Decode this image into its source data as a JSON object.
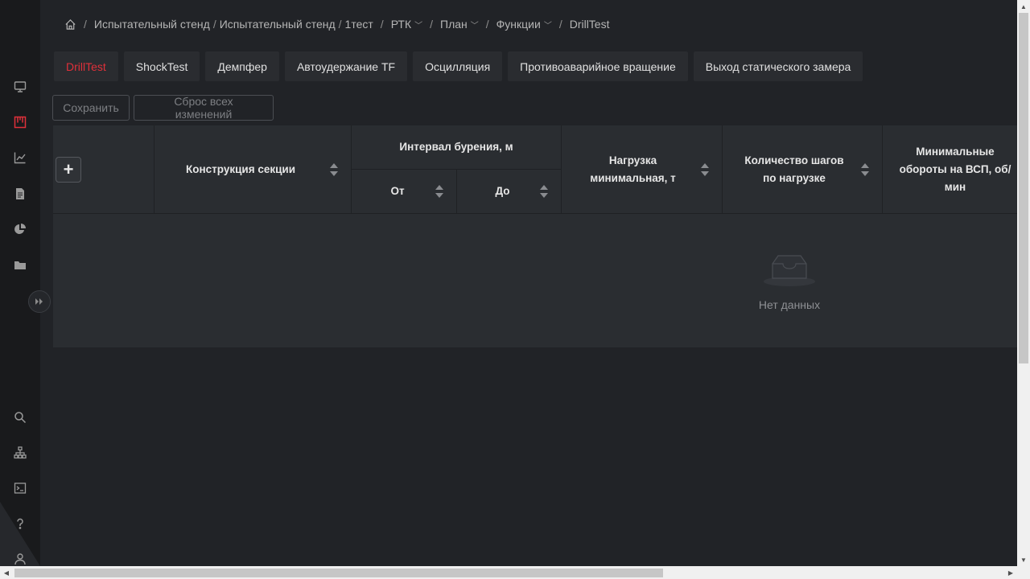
{
  "breadcrumb": {
    "items": [
      "Испытательный стенд",
      "Испытательный стенд",
      "1тест",
      "РТК",
      "План",
      "Функции",
      "DrillTest"
    ]
  },
  "tabs": [
    {
      "label": "DrillTest",
      "active": true
    },
    {
      "label": "ShockTest"
    },
    {
      "label": "Демпфер"
    },
    {
      "label": "Автоудержание TF"
    },
    {
      "label": "Осцилляция"
    },
    {
      "label": "Противоаварийное вращение"
    },
    {
      "label": "Выход статического замера"
    }
  ],
  "toolbar": {
    "save_label": "Сохранить",
    "reset_label": "Сброс всех изменений"
  },
  "table": {
    "headers": {
      "add": "+",
      "section": "Конструкция секции",
      "interval": "Интервал бурения, м",
      "from": "От",
      "to": "До",
      "load_min": "Нагрузка минимальная, т",
      "load_steps": "Количество шагов по нагрузке",
      "rpm_min": "Минимальные обороты на ВСП, об/мин"
    },
    "empty_text": "Нет данных"
  },
  "colors": {
    "accent": "#e0303a",
    "background": "#212327",
    "sidebar": "#191a1c"
  },
  "sidebar_icons": [
    "monitor-icon",
    "kanban-icon",
    "chart-line-icon",
    "document-icon",
    "pie-icon",
    "folder-icon",
    "search-icon",
    "network-icon",
    "terminal-icon",
    "help-icon",
    "user-icon"
  ]
}
